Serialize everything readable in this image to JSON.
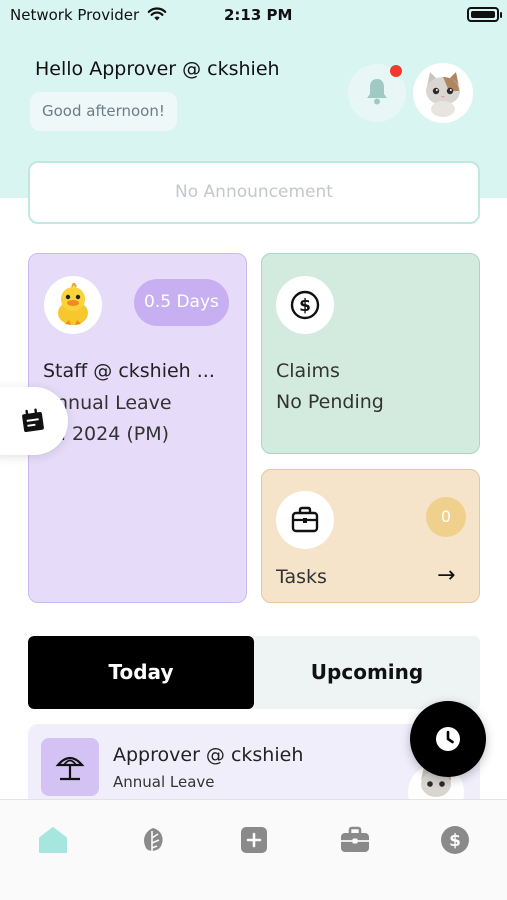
{
  "status_bar": {
    "carrier": "Network Provider",
    "time": "2:13 PM"
  },
  "header": {
    "greeting": "Hello Approver @ ckshieh",
    "subgreeting": "Good afternoon!",
    "notification_icon": "bell-icon",
    "has_unread_notification": true
  },
  "announcement": {
    "text": "No Announcement"
  },
  "leave_card": {
    "days": "0.5 Days",
    "name": "Staff @ ckshieh ...",
    "leave_type": "Annual Leave",
    "date": "Jul 2024 (PM)",
    "color": "#e6dcfa"
  },
  "claims_card": {
    "title": "Claims",
    "status": "No Pending",
    "icon": "dollar-circle-icon",
    "color": "#d3ebdf"
  },
  "tasks_card": {
    "title": "Tasks",
    "count": "0",
    "icon": "briefcase-icon",
    "arrow": "→",
    "color": "#f5e4c9"
  },
  "segment": {
    "today": "Today",
    "upcoming": "Upcoming",
    "selected": "today"
  },
  "list": [
    {
      "title": "Approver @ ckshieh",
      "subtitle": "Annual Leave",
      "icon": "umbrella-icon"
    }
  ],
  "fab": {
    "icon": "clock-icon"
  },
  "tab_bar": {
    "items": [
      {
        "name": "home",
        "icon": "home-icon",
        "active": true
      },
      {
        "name": "leave",
        "icon": "leaf-icon",
        "active": false
      },
      {
        "name": "add",
        "icon": "plus-square-icon",
        "active": false
      },
      {
        "name": "work",
        "icon": "briefcase-icon",
        "active": false
      },
      {
        "name": "claims",
        "icon": "dollar-circle-icon",
        "active": false
      }
    ],
    "active_color": "#7fd8cf",
    "inactive_color": "#8a8a8a"
  },
  "accent_color": "#d8f5f1"
}
